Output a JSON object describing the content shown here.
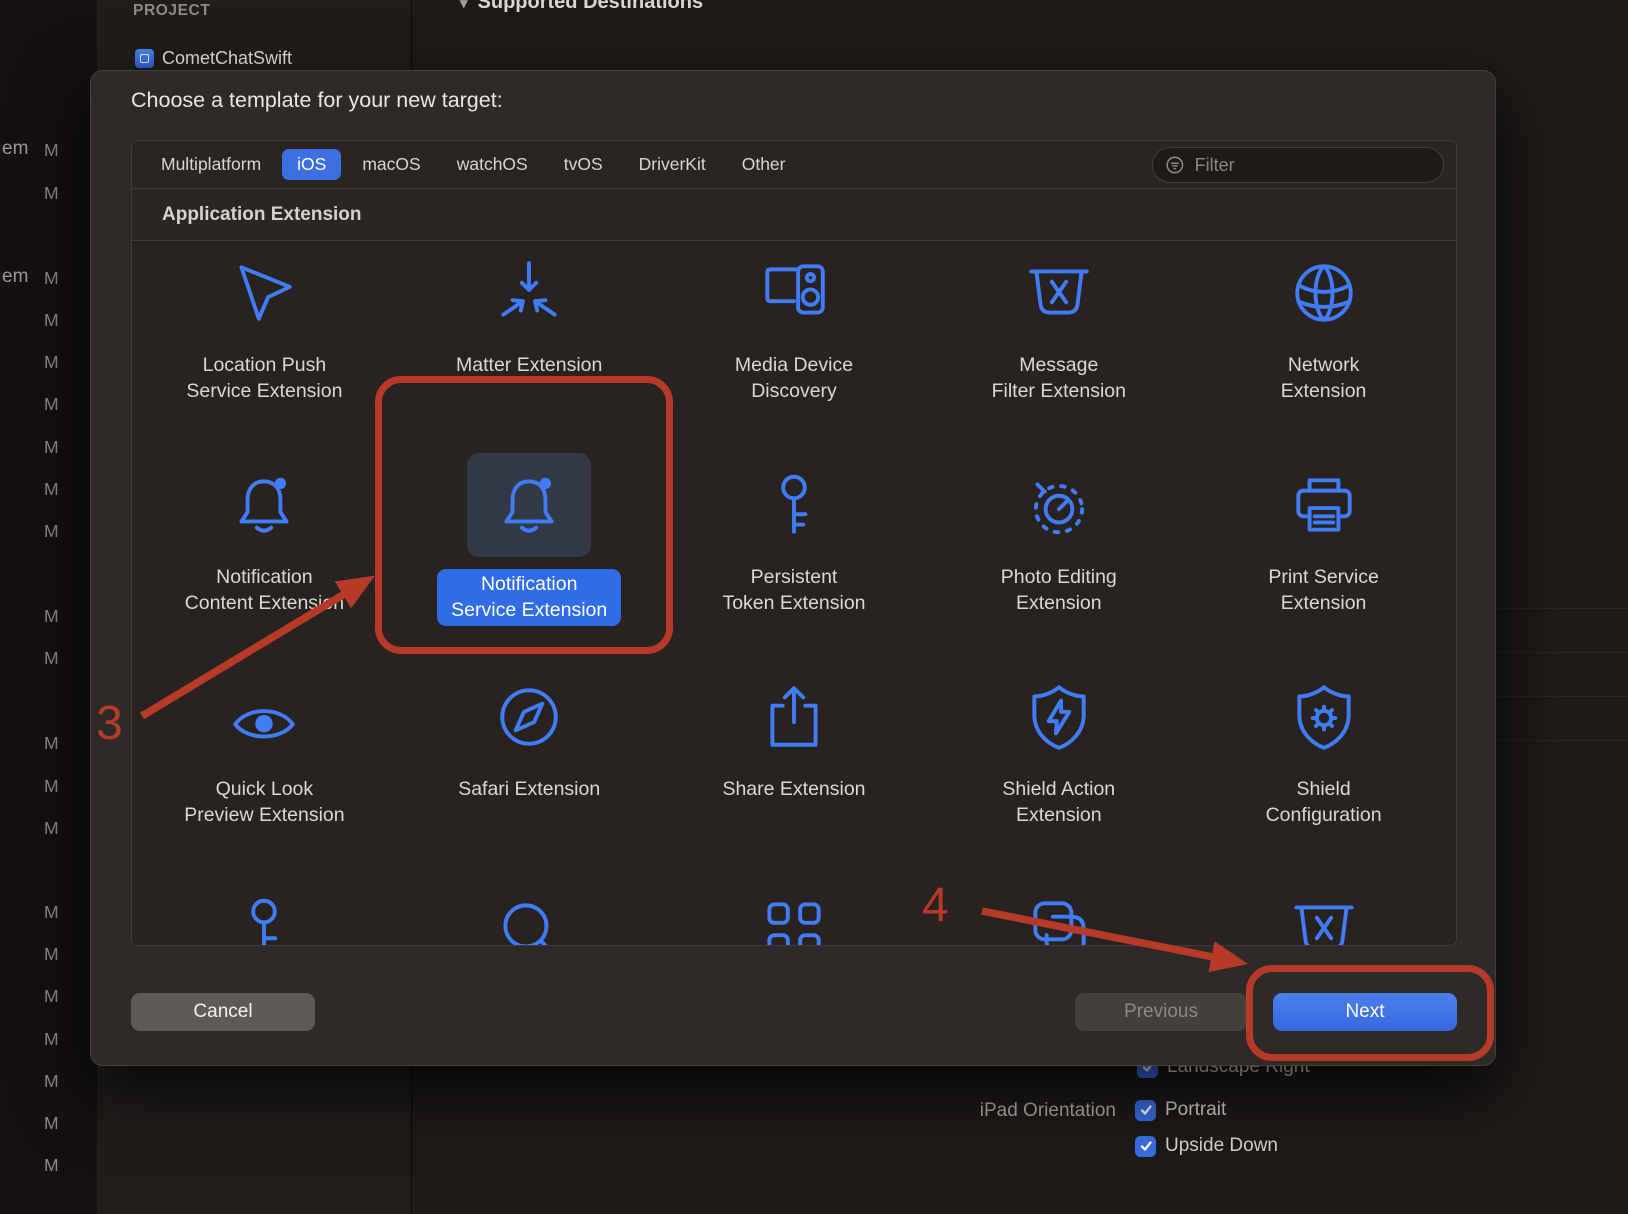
{
  "colors": {
    "accent_blue": "#3f7cf6",
    "selection_blue": "#2f6ce6",
    "annotation_red": "#b73a28"
  },
  "background": {
    "project_section_label": "PROJECT",
    "project_name": "CometChatSwift",
    "editor_header": "Supported Destinations",
    "modified_badge": "M",
    "filename_fragment": "em",
    "ipad_orientation": {
      "label": "iPad Orientation",
      "options": [
        {
          "label": "Landscape Right",
          "checked": true
        },
        {
          "label": "Portrait",
          "checked": true
        },
        {
          "label": "Upside Down",
          "checked": true
        }
      ]
    }
  },
  "dialog": {
    "title": "Choose a template for your new target:",
    "tabs": [
      {
        "label": "Multiplatform",
        "selected": false
      },
      {
        "label": "iOS",
        "selected": true
      },
      {
        "label": "macOS",
        "selected": false
      },
      {
        "label": "watchOS",
        "selected": false
      },
      {
        "label": "tvOS",
        "selected": false
      },
      {
        "label": "DriverKit",
        "selected": false
      },
      {
        "label": "Other",
        "selected": false
      }
    ],
    "filter_placeholder": "Filter",
    "section_header": "Application Extension",
    "templates": [
      {
        "label": "Location Push\nService Extension",
        "icon": "location-push-icon",
        "selected": false
      },
      {
        "label": "Matter Extension",
        "icon": "matter-icon",
        "selected": false
      },
      {
        "label": "Media Device\nDiscovery",
        "icon": "media-device-icon",
        "selected": false
      },
      {
        "label": "Message\nFilter Extension",
        "icon": "filter-basket-icon",
        "selected": false
      },
      {
        "label": "Network\nExtension",
        "icon": "globe-icon",
        "selected": false
      },
      {
        "label": "Notification\nContent Extension",
        "icon": "bell-icon",
        "selected": false
      },
      {
        "label": "Notification\nService Extension",
        "icon": "bell-icon",
        "selected": true
      },
      {
        "label": "Persistent\nToken Extension",
        "icon": "key-icon",
        "selected": false
      },
      {
        "label": "Photo Editing\nExtension",
        "icon": "dial-icon",
        "selected": false
      },
      {
        "label": "Print Service\nExtension",
        "icon": "printer-icon",
        "selected": false
      },
      {
        "label": "Quick Look\nPreview Extension",
        "icon": "eye-icon",
        "selected": false
      },
      {
        "label": "Safari Extension",
        "icon": "compass-icon",
        "selected": false
      },
      {
        "label": "Share Extension",
        "icon": "share-icon",
        "selected": false
      },
      {
        "label": "Shield Action\nExtension",
        "icon": "shield-bolt-icon",
        "selected": false
      },
      {
        "label": "Shield\nConfiguration",
        "icon": "shield-gear-icon",
        "selected": false
      }
    ],
    "partial_row_icons": [
      "key-icon",
      "search-icon",
      "app-library-icon",
      "scene-icon",
      "filter-basket-icon"
    ],
    "buttons": {
      "cancel_label": "Cancel",
      "previous_label": "Previous",
      "next_label": "Next"
    }
  },
  "annotations": {
    "step_3": "3",
    "step_4": "4"
  }
}
